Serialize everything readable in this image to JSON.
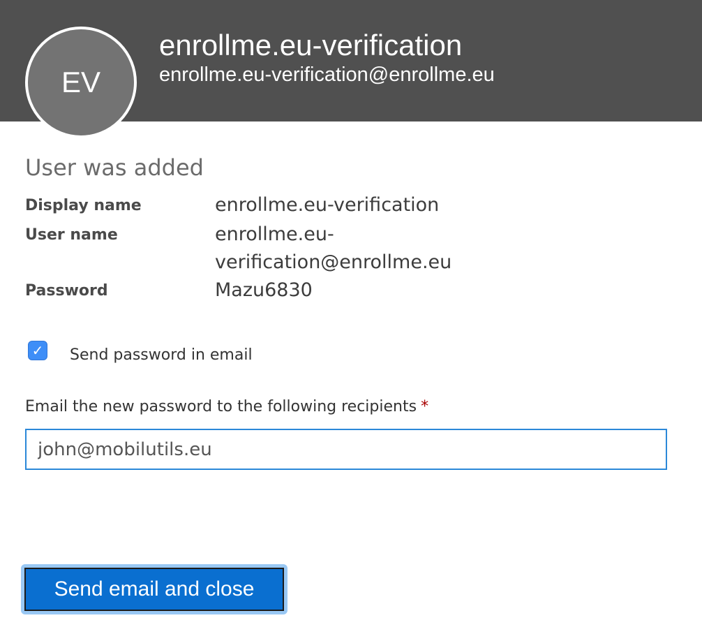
{
  "header": {
    "avatar_initials": "EV",
    "display_name": "enrollme.eu-verification",
    "email": "enrollme.eu-verification@enrollme.eu",
    "background_color": "#505050"
  },
  "status": {
    "title": "User was added"
  },
  "details": {
    "display_name_label": "Display name",
    "display_name_value": "enrollme.eu-verification",
    "user_name_label": "User name",
    "user_name_value": "enrollme.eu-verification@enrollme.eu",
    "password_label": "Password",
    "password_value": "Mazu6830"
  },
  "send_password": {
    "checked": true,
    "label": "Send password in email"
  },
  "recipients": {
    "label": "Email the new password to the following recipients",
    "required_marker": "*",
    "value": "john@mobilutils.eu"
  },
  "actions": {
    "send_label": "Send email and close",
    "accent_color": "#0a6fd0"
  }
}
